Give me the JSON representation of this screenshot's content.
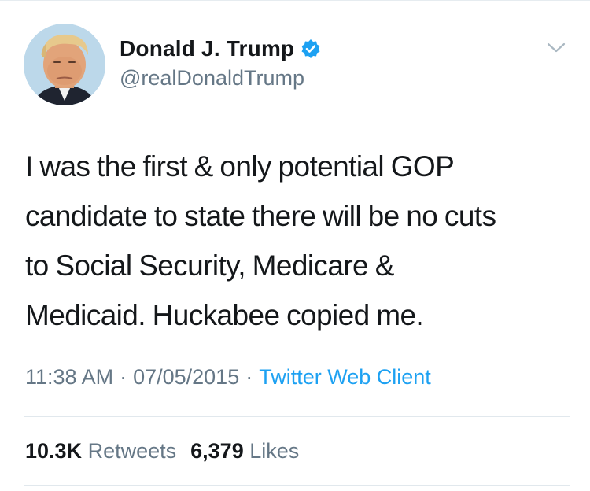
{
  "user": {
    "display_name": "Donald J. Trump",
    "handle": "@realDonaldTrump",
    "verified": true,
    "avatar_icon": "profile-photo"
  },
  "tweet": {
    "line1": "I was the first & only potential GOP",
    "line2": "candidate to state there will be no cuts",
    "line3": "to Social Security, Medicare &",
    "line4": "Medicaid. Huckabee copied me."
  },
  "meta": {
    "time": "11:38 AM",
    "date": "07/05/2015",
    "separator": "·",
    "source": "Twitter Web Client"
  },
  "stats": {
    "retweets_count": "10.3K",
    "retweets_label": "Retweets",
    "likes_count": "6,379",
    "likes_label": "Likes"
  },
  "colors": {
    "text": "#14171a",
    "secondary": "#657786",
    "accent": "#1da1f2",
    "divider": "#e1e8ed"
  }
}
